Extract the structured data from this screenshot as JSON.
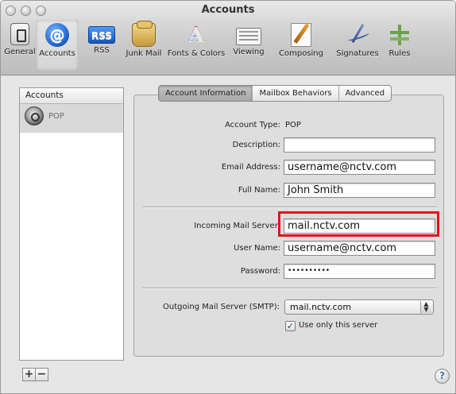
{
  "window": {
    "title": "Accounts"
  },
  "toolbar": {
    "items": [
      {
        "label": "General",
        "icon": "general-switch-icon"
      },
      {
        "label": "Accounts",
        "icon": "at-sign-icon",
        "selected": true
      },
      {
        "label": "RSS",
        "icon": "rss-icon",
        "badge": "RSS"
      },
      {
        "label": "Junk Mail",
        "icon": "junk-mail-bag-icon"
      },
      {
        "label": "Fonts & Colors",
        "icon": "fonts-colors-icon",
        "glyph": "A"
      },
      {
        "label": "Viewing",
        "icon": "viewing-glasses-icon"
      },
      {
        "label": "Composing",
        "icon": "composing-pencil-icon"
      },
      {
        "label": "Signatures",
        "icon": "signature-pen-icon"
      },
      {
        "label": "Rules",
        "icon": "rules-signpost-icon"
      }
    ]
  },
  "accounts_list": {
    "header": "Accounts",
    "items": [
      {
        "name": "POP",
        "icon": "pop-account-icon"
      }
    ]
  },
  "tabs": [
    {
      "label": "Account Information",
      "selected": true
    },
    {
      "label": "Mailbox Behaviors"
    },
    {
      "label": "Advanced"
    }
  ],
  "form": {
    "account_type": {
      "label": "Account Type:",
      "value": "POP"
    },
    "description": {
      "label": "Description:",
      "value": ""
    },
    "email_address": {
      "label": "Email Address:",
      "value": "username@nctv.com"
    },
    "full_name": {
      "label": "Full Name:",
      "value": "John Smith"
    },
    "incoming_server": {
      "label": "Incoming Mail Server:",
      "value": "mail.nctv.com"
    },
    "user_name": {
      "label": "User Name:",
      "value": "username@nctv.com"
    },
    "password": {
      "label": "Password:",
      "value": "••••••••••"
    },
    "outgoing_server": {
      "label": "Outgoing Mail Server (SMTP):",
      "value": "mail.nctv.com"
    },
    "use_only_server": {
      "label": "Use only this server",
      "checked": true
    }
  },
  "bottom": {
    "add": "+",
    "remove": "−",
    "help": "?"
  },
  "colors": {
    "highlight": "#e0151c",
    "selection": "#d9d9d9"
  }
}
